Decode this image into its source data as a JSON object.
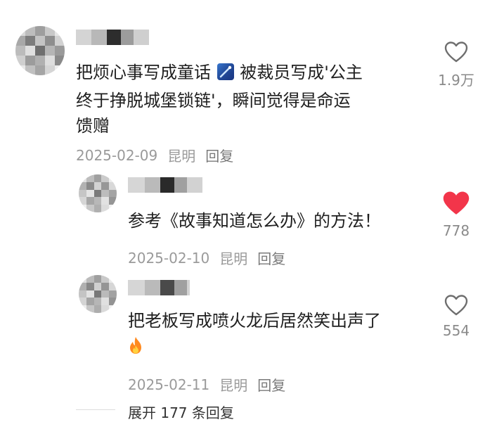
{
  "colors": {
    "liked_heart": "#f2354a",
    "meta_gray": "#9a9a9a",
    "text": "#1f1f1f"
  },
  "comments": [
    {
      "text_line1": "把烦心事写成童话",
      "text_line1_b": "被裁员写成'公主",
      "text_line2": "终于挣脱城堡锁链'，瞬间觉得是命运",
      "text_line3": "馈赠",
      "inline_icon": "shooting-star-icon",
      "date": "2025-02-09",
      "location": "昆明",
      "reply_label": "回复",
      "likes": "1.9万",
      "liked": false
    },
    {
      "text_line1": "参考《故事知道怎么办》的方法！",
      "date": "2025-02-10",
      "location": "昆明",
      "reply_label": "回复",
      "likes": "778",
      "liked": true
    },
    {
      "text_line1": "把老板写成喷火龙后居然笑出声了",
      "inline_icon": "fire-icon",
      "date": "2025-02-11",
      "location": "昆明",
      "reply_label": "回复",
      "likes": "554",
      "liked": false
    }
  ],
  "expand_replies": "展开 177 条回复"
}
